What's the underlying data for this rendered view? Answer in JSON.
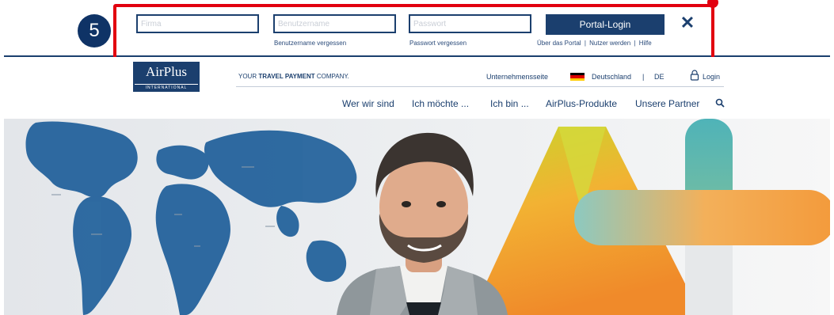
{
  "step": {
    "number": "5"
  },
  "login": {
    "company_placeholder": "Firma",
    "username_placeholder": "Benutzername",
    "password_placeholder": "Passwort",
    "forgot_username": "Benutzername vergessen",
    "forgot_password": "Passwort vergessen",
    "submit_label": "Portal-Login",
    "close_label": "✕",
    "links": [
      "Über das Portal",
      "Nutzer werden",
      "Hilfe"
    ],
    "separator": "|"
  },
  "header": {
    "logo_text": "AirPlus",
    "logo_sub": "INTERNATIONAL",
    "tagline_pre": "YOUR ",
    "tagline_bold": "TRAVEL PAYMENT",
    "tagline_post": " COMPANY.",
    "company_page": "Unternehmensseite",
    "country": "Deutschland",
    "separator": "|",
    "language": "DE",
    "login": "Login"
  },
  "nav": {
    "items": [
      "Wer wir sind",
      "Ich möchte ...",
      "Ich bin ...",
      "AirPlus-Produkte",
      "Unsere Partner"
    ]
  },
  "colors": {
    "brand_navy": "#1b3f6e",
    "highlight_red": "#e2000f",
    "flag": [
      "#000000",
      "#dd0000",
      "#ffcc00"
    ]
  },
  "icons": [
    "close-icon",
    "flag-de-icon",
    "lock-icon",
    "search-icon"
  ]
}
